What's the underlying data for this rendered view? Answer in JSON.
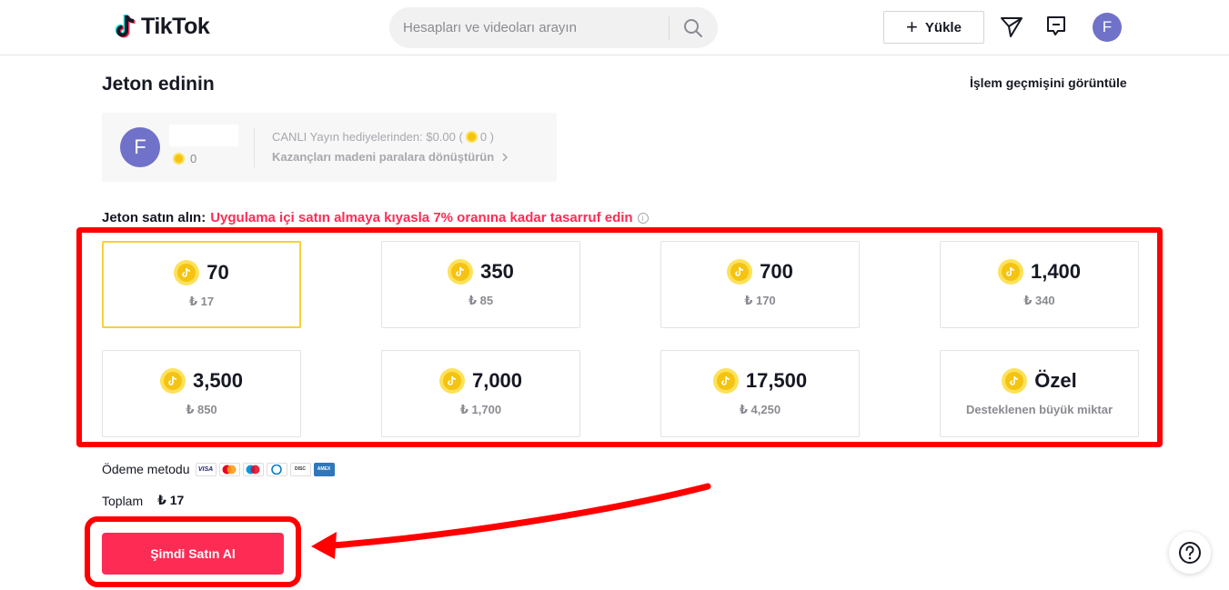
{
  "header": {
    "logo_text": "TikTok",
    "search_placeholder": "Hesapları ve videoları arayın",
    "upload_label": "Yükle",
    "avatar_letter": "F"
  },
  "page": {
    "title": "Jeton edinin",
    "history_link": "İşlem geçmişini görüntüle"
  },
  "profile": {
    "avatar_letter": "F",
    "coin_balance": "0",
    "live_gifts_text": "CANLI Yayın hediyelerinden: $0.00 (",
    "live_gifts_coins": "0 )",
    "convert_link": "Kazançları madeni paralara dönüştürün"
  },
  "buy": {
    "label": "Jeton satın alın:",
    "promo": "Uygulama içi satın almaya kıyasla 7% oranına kadar tasarruf edin",
    "packages": [
      {
        "amount": "70",
        "price": "₺ 17",
        "selected": true
      },
      {
        "amount": "350",
        "price": "₺ 85"
      },
      {
        "amount": "700",
        "price": "₺ 170"
      },
      {
        "amount": "1,400",
        "price": "₺ 340"
      },
      {
        "amount": "3,500",
        "price": "₺ 850"
      },
      {
        "amount": "7,000",
        "price": "₺ 1,700"
      },
      {
        "amount": "17,500",
        "price": "₺ 4,250"
      },
      {
        "amount": "Özel",
        "price": "Desteklenen büyük miktar"
      }
    ]
  },
  "payment": {
    "label": "Ödeme metodu",
    "cards": [
      "visa",
      "mastercard",
      "maestro",
      "diners",
      "discover",
      "amex"
    ]
  },
  "total": {
    "label": "Toplam",
    "amount": "₺ 17"
  },
  "buy_button": "Şimdi Satın Al",
  "colors": {
    "accent": "#fe2c55",
    "annotation": "#ff0000",
    "coin": "#f5c311",
    "selected_border": "#f5d23a"
  }
}
